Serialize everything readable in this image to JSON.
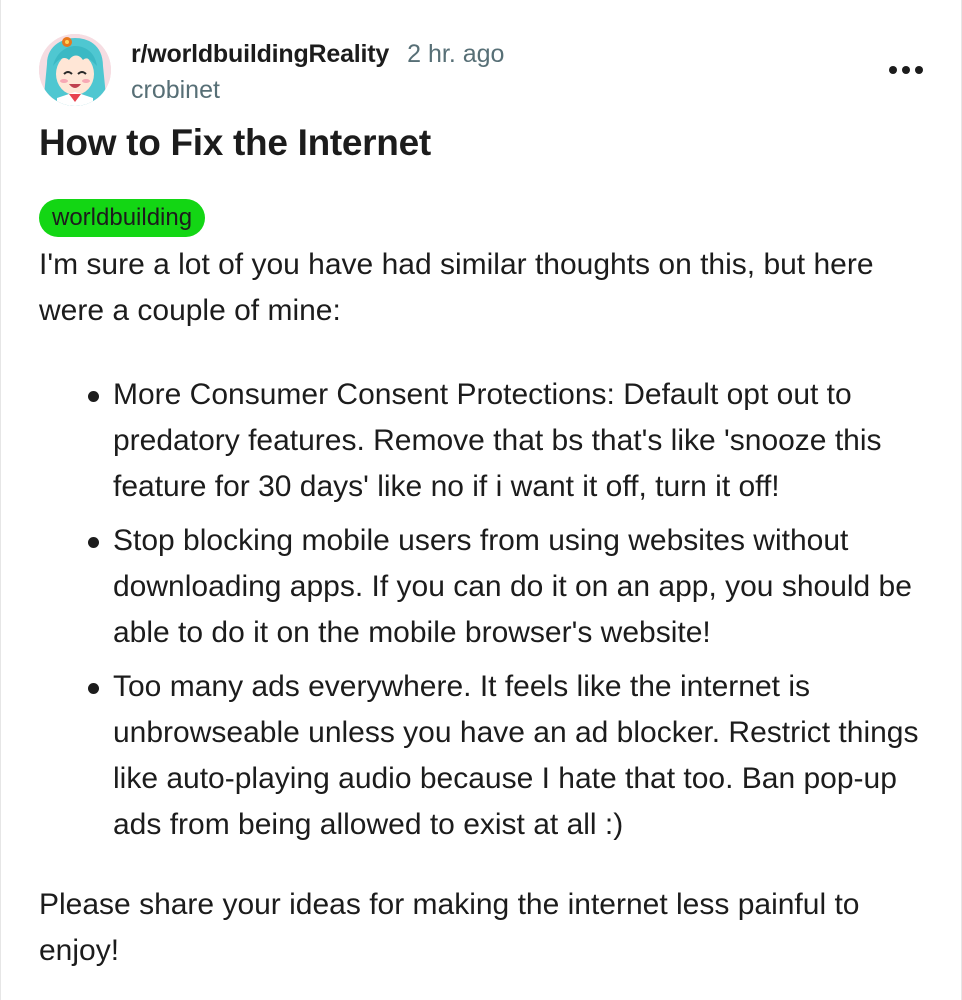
{
  "post": {
    "subreddit": "r/worldbuildingReality",
    "timestamp": "2 hr. ago",
    "author": "crobinet",
    "title": "How to Fix the Internet",
    "flair": "worldbuilding",
    "flair_color": "#13d614",
    "intro": "I'm sure a lot of you have had similar thoughts on this, but here were a couple of mine:",
    "bullets": [
      "More Consumer Consent Protections: Default opt out to predatory features. Remove that bs that's like 'snooze this feature for 30 days' like no if i want it off, turn it off!",
      "Stop blocking mobile users from using websites without downloading apps. If you can do it on an app, you should be able to do it on the mobile browser's website!",
      "Too many ads everywhere. It feels like the internet is unbrowseable unless you have an ad blocker. Restrict things like auto-playing audio because I hate that too. Ban pop-up ads from being allowed to exist at all :)"
    ],
    "closing": "Please share your ideas for making the internet less painful to enjoy!"
  },
  "icons": {
    "avatar": "anime-avatar-icon",
    "more": "more-options-icon"
  }
}
